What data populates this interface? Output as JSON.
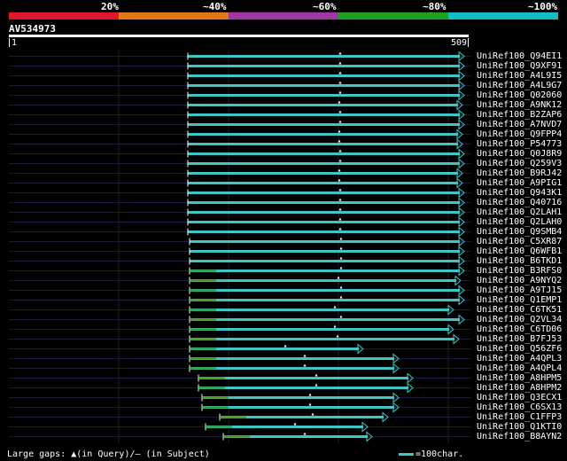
{
  "identity_scale": {
    "labels": [
      "20%",
      "~40%",
      "~60%",
      "~80%",
      "~100%"
    ],
    "colors": [
      "#e0162c",
      "#e0781a",
      "#a236a6",
      "#1ea01e",
      "#15bcc4"
    ]
  },
  "query": {
    "id": "AV534973",
    "start": "1",
    "end": "509"
  },
  "colors": {
    "hit": "#3cc6c6",
    "gap": "#3a9a1a",
    "guide": "#1a1a3c",
    "connector": "#1a9a1a"
  },
  "hits": [
    {
      "id": "UniRef100_Q94EI1",
      "start": 212,
      "end": 524
    },
    {
      "id": "UniRef100_Q9XF91",
      "start": 212,
      "end": 524
    },
    {
      "id": "UniRef100_A4L9I5",
      "start": 212,
      "end": 524
    },
    {
      "id": "UniRef100_A4L9G7",
      "start": 212,
      "end": 524
    },
    {
      "id": "UniRef100_Q02060",
      "start": 212,
      "end": 524
    },
    {
      "id": "UniRef100_A9NK12",
      "start": 212,
      "end": 522
    },
    {
      "id": "UniRef100_B2ZAP6",
      "start": 212,
      "end": 524
    },
    {
      "id": "UniRef100_A7NVD7",
      "start": 212,
      "end": 524
    },
    {
      "id": "UniRef100_Q9FPP4",
      "start": 212,
      "end": 522
    },
    {
      "id": "UniRef100_P54773",
      "start": 212,
      "end": 522
    },
    {
      "id": "UniRef100_Q0J8R9",
      "start": 212,
      "end": 524
    },
    {
      "id": "UniRef100_Q259V3",
      "start": 212,
      "end": 524
    },
    {
      "id": "UniRef100_B9RJ42",
      "start": 212,
      "end": 522
    },
    {
      "id": "UniRef100_A9PIG1",
      "start": 212,
      "end": 522
    },
    {
      "id": "UniRef100_Q943K1",
      "start": 212,
      "end": 524
    },
    {
      "id": "UniRef100_Q40716",
      "start": 212,
      "end": 524
    },
    {
      "id": "UniRef100_Q2LAH1",
      "start": 212,
      "end": 524
    },
    {
      "id": "UniRef100_Q2LAH0",
      "start": 212,
      "end": 524
    },
    {
      "id": "UniRef100_Q9SMB4",
      "start": 212,
      "end": 524
    },
    {
      "id": "UniRef100_C5XR87",
      "start": 214,
      "end": 524
    },
    {
      "id": "UniRef100_Q6WFB1",
      "start": 214,
      "end": 524
    },
    {
      "id": "UniRef100_B6TKD1",
      "start": 214,
      "end": 524
    },
    {
      "id": "UniRef100_B3RFS0",
      "start": 214,
      "end": 524
    },
    {
      "id": "UniRef100_A9NYQ2",
      "start": 214,
      "end": 520
    },
    {
      "id": "UniRef100_A9TJ15",
      "start": 214,
      "end": 524
    },
    {
      "id": "UniRef100_Q1EMP1",
      "start": 214,
      "end": 524
    },
    {
      "id": "UniRef100_C6TK51",
      "start": 214,
      "end": 512
    },
    {
      "id": "UniRef100_Q2VL34",
      "start": 214,
      "end": 524
    },
    {
      "id": "UniRef100_C6TD06",
      "start": 214,
      "end": 512
    },
    {
      "id": "UniRef100_B7FJ53",
      "start": 214,
      "end": 518
    },
    {
      "id": "UniRef100_Q56ZF6",
      "start": 214,
      "end": 410
    },
    {
      "id": "UniRef100_A4QPL3",
      "start": 214,
      "end": 450
    },
    {
      "id": "UniRef100_A4QPL4",
      "start": 214,
      "end": 450
    },
    {
      "id": "UniRef100_A8HPM5",
      "start": 224,
      "end": 466
    },
    {
      "id": "UniRef100_A8HPM2",
      "start": 224,
      "end": 466
    },
    {
      "id": "UniRef100_Q3ECX1",
      "start": 228,
      "end": 450
    },
    {
      "id": "UniRef100_C6SX13",
      "start": 228,
      "end": 450
    },
    {
      "id": "UniRef100_C1FFP3",
      "start": 248,
      "end": 438
    },
    {
      "id": "UniRef100_Q1KTI0",
      "start": 232,
      "end": 415
    },
    {
      "id": "UniRef100_B8AYN2",
      "start": 252,
      "end": 420
    }
  ],
  "footer": {
    "gaps_label": "Large gaps: ▲(in Query)/— (in Subject)"
  },
  "legend": {
    "label": "=100char."
  }
}
